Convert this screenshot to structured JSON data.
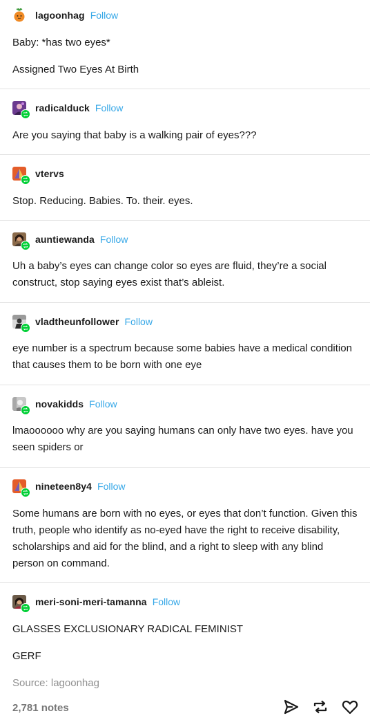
{
  "posts": [
    {
      "username": "lagoonhag",
      "follow": "Follow",
      "avatar_icon": "orange-fruit-avatar-icon",
      "paragraphs": [
        "Baby: *has two eyes*",
        "Assigned Two Eyes At Birth"
      ]
    },
    {
      "username": "radicalduck",
      "follow": "Follow",
      "avatar_icon": "purple-portrait-avatar-icon",
      "paragraphs": [
        "Are you saying that baby is a walking pair of eyes???"
      ]
    },
    {
      "username": "vtervs",
      "follow": "",
      "avatar_icon": "triangle-logo-avatar-icon",
      "paragraphs": [
        "Stop. Reducing. Babies. To. their. eyes."
      ]
    },
    {
      "username": "auntiewanda",
      "follow": "Follow",
      "avatar_icon": "woman-portrait-avatar-icon",
      "paragraphs": [
        "Uh a baby’s eyes can change color so eyes are fluid,  they’re a social construct, stop saying eyes exist that’s ableist."
      ]
    },
    {
      "username": "vladtheunfollower",
      "follow": "Follow",
      "avatar_icon": "dark-figure-avatar-icon",
      "paragraphs": [
        "eye number is a spectrum because some babies have a medical condition that causes them to be born with one eye"
      ]
    },
    {
      "username": "novakidds",
      "follow": "Follow",
      "avatar_icon": "grey-photo-avatar-icon",
      "paragraphs": [
        "lmaoooooo why are you saying humans can only have two eyes. have you seen spiders or"
      ]
    },
    {
      "username": "nineteen8y4",
      "follow": "Follow",
      "avatar_icon": "triangle-logo-avatar-icon",
      "paragraphs": [
        "Some humans are born with no eyes, or eyes that don’t function. Given this truth, people who identify as no-eyed have the right to receive disability, scholarships and aid for the blind, and a right to sleep with any blind person on command."
      ]
    },
    {
      "username": "meri-soni-meri-tamanna",
      "follow": "Follow",
      "avatar_icon": "woman-portrait-avatar-icon",
      "paragraphs": [
        "GLASSES EXCLUSIONARY RADICAL FEMINIST",
        "GERF"
      ]
    }
  ],
  "footer": {
    "source": "Source: lagoonhag",
    "notes": "2,781 notes",
    "actions": [
      "share-icon",
      "reblog-icon",
      "heart-icon"
    ]
  },
  "colors": {
    "follow": "#35a7e7",
    "reblog_badge": "#00cf35",
    "divider": "#e2e2e2",
    "muted": "#8f8f8f"
  }
}
